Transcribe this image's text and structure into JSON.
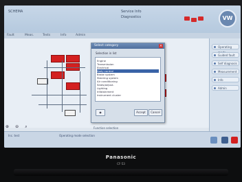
{
  "app": {
    "title_left": "SCHEMA",
    "title_mid": "Service Info",
    "title_right": "Diagnostics"
  },
  "menu": [
    "Fault",
    "Meas.",
    "Tests",
    "Info",
    "Admin"
  ],
  "right_panel": {
    "items": [
      "Operating mode",
      "Guided fault",
      "Self diagnosis",
      "Measurement",
      "Info",
      "Admin"
    ]
  },
  "dialog": {
    "title": "Select category",
    "label": "Selection in list",
    "list_items": [
      "Engine",
      "Transmission",
      "Electrical",
      "Body control",
      "Brake system",
      "Steering system",
      "Air conditioning",
      "Seats/adjust.",
      "Lighting",
      "Infotainment",
      "Instrument cluster"
    ],
    "selected_index": 3,
    "buttons": {
      "left": "◉",
      "ok": "Accept",
      "cancel": "Cancel"
    }
  },
  "statusline": "Function selection",
  "bottombar": {
    "left": "Inc. test",
    "mid": "Operating mode selection"
  },
  "laptop": {
    "brand": "Panasonic",
    "model": "CF-53"
  },
  "colors": {
    "accent": "#3a63a7",
    "red": "#d32020",
    "screen_bg": "#dfe6ee"
  }
}
